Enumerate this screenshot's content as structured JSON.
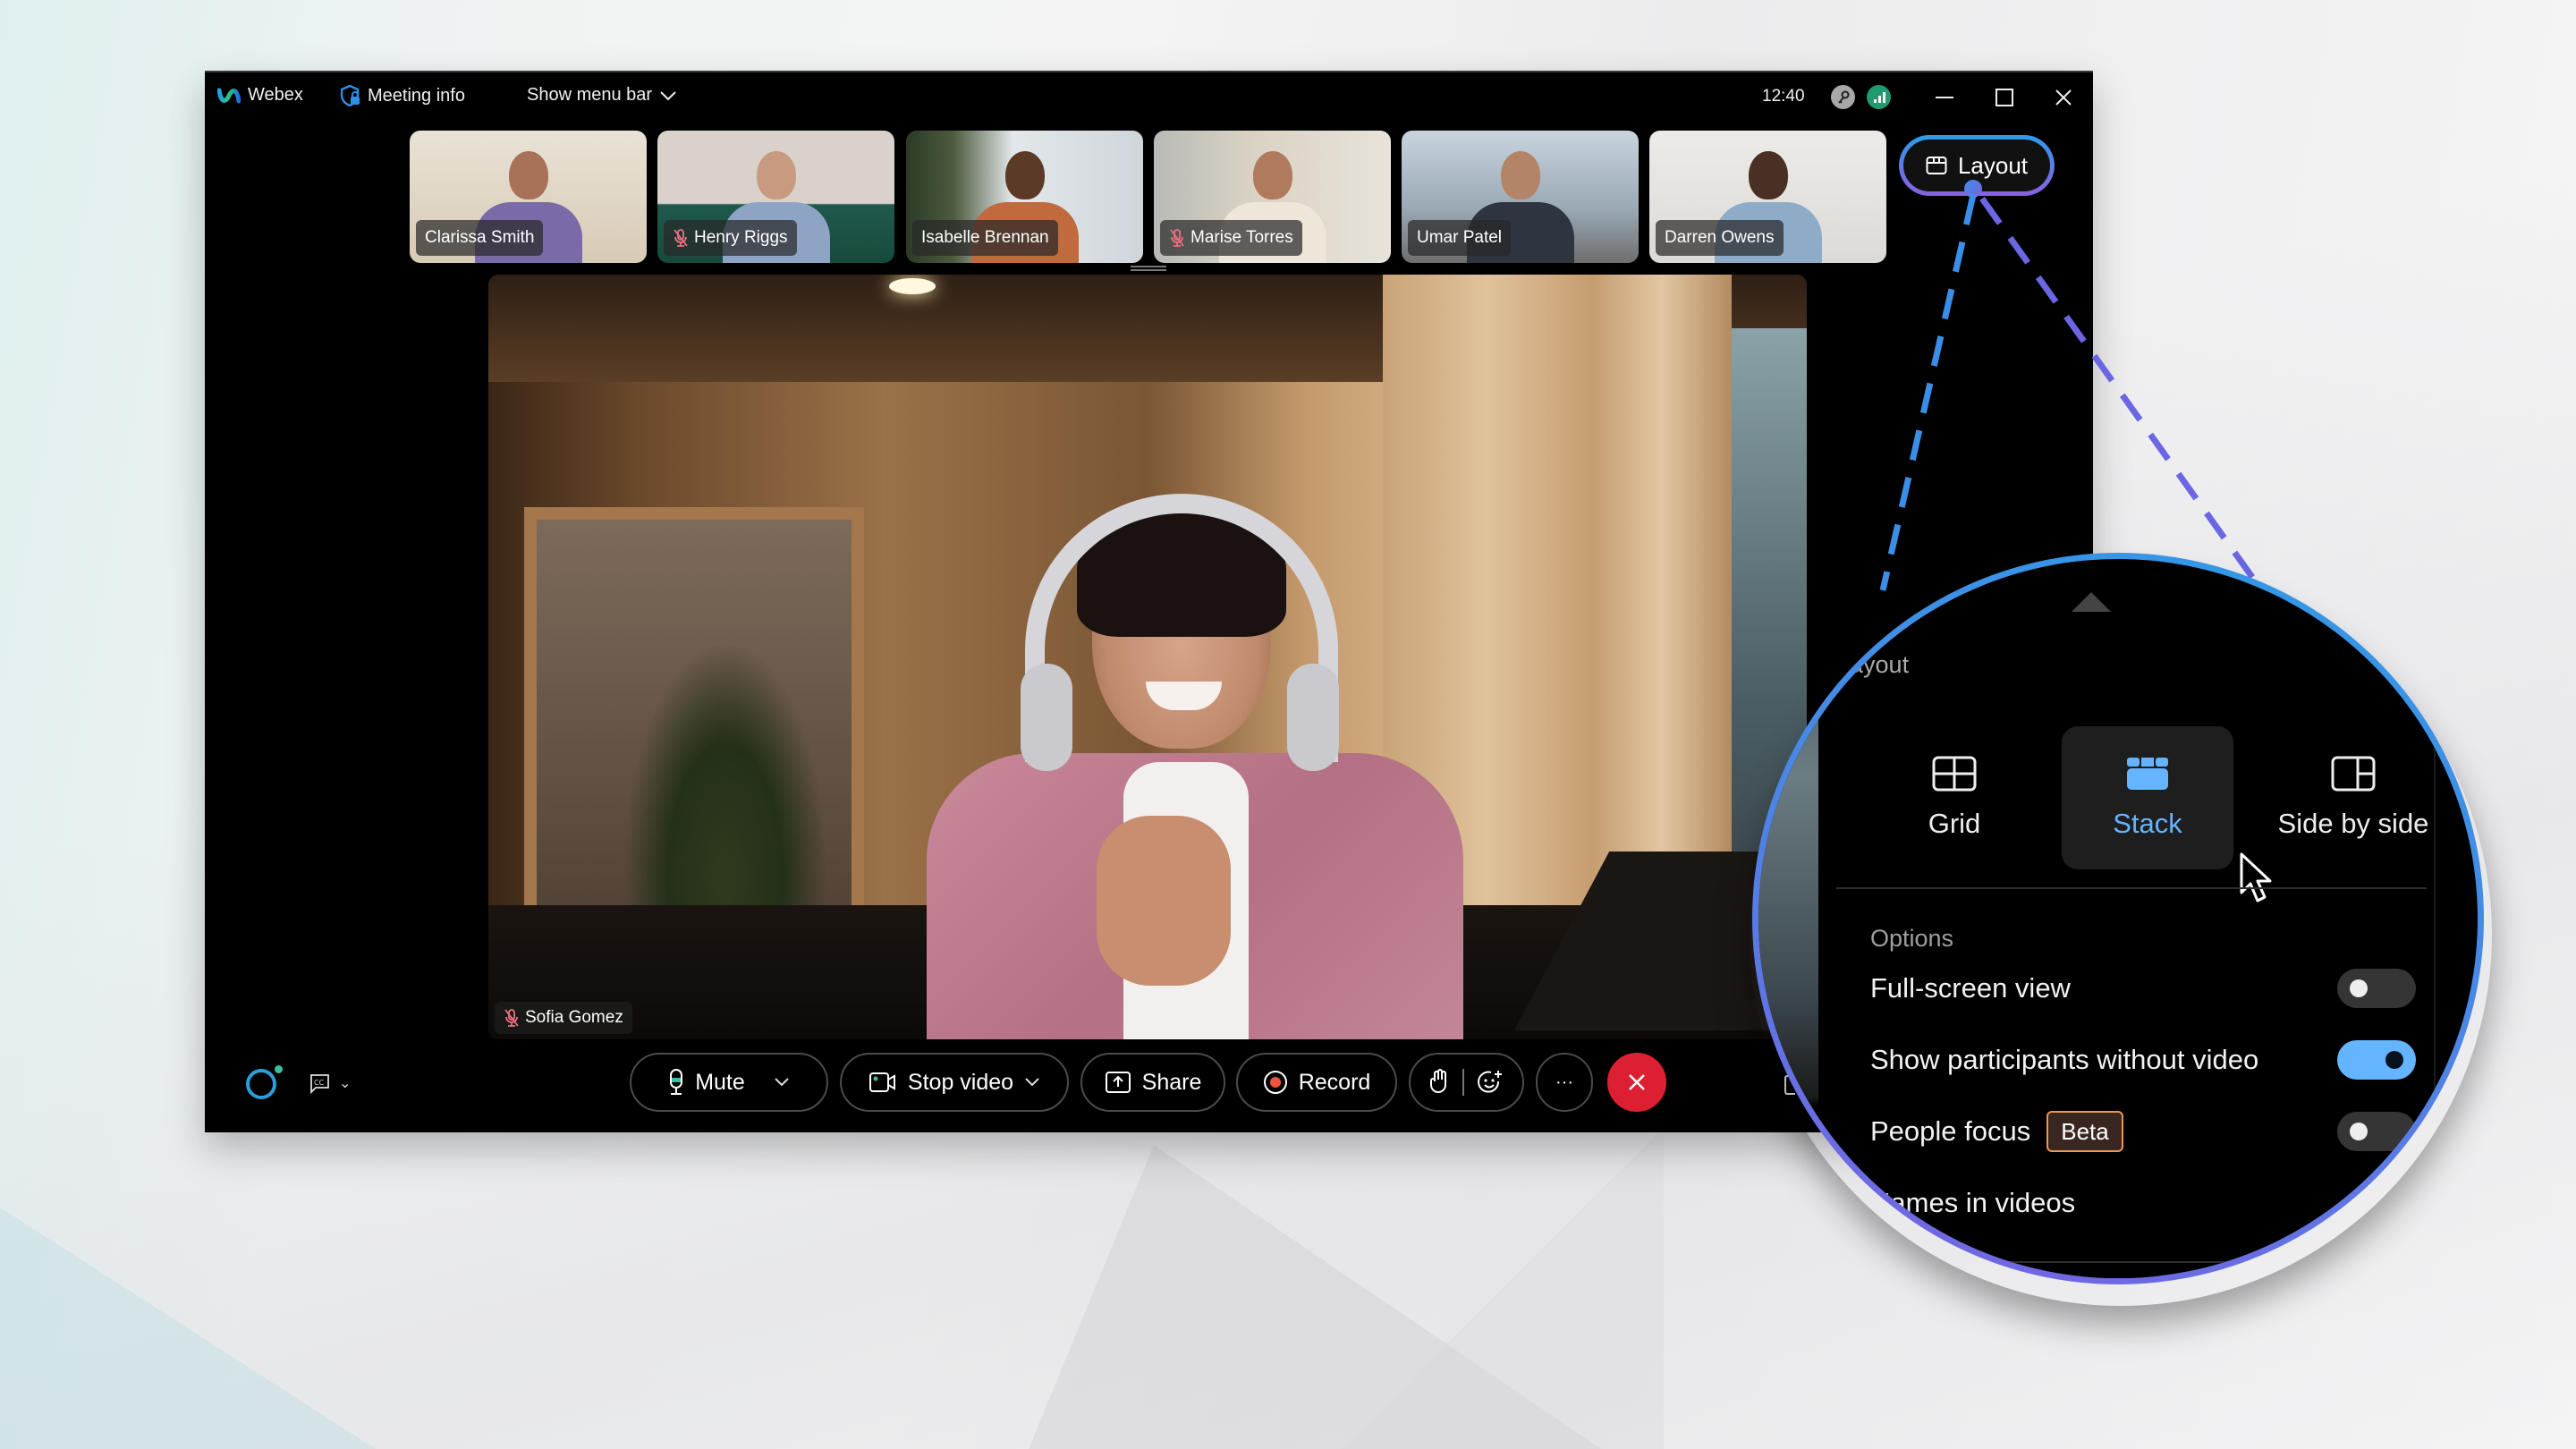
{
  "titlebar": {
    "app_name": "Webex",
    "meeting_info": "Meeting info",
    "show_menu_bar": "Show menu bar",
    "time": "12:40",
    "icons": [
      "webex-logo-icon",
      "shield-lock-icon",
      "chevron-down-icon",
      "key-icon",
      "signal-icon",
      "minimize-icon",
      "maximize-icon",
      "close-icon"
    ]
  },
  "participants": [
    {
      "name": "Clarissa Smith",
      "muted": false
    },
    {
      "name": "Henry Riggs",
      "muted": true
    },
    {
      "name": "Isabelle Brennan",
      "muted": false
    },
    {
      "name": "Marise Torres",
      "muted": true
    },
    {
      "name": "Umar Patel",
      "muted": false
    },
    {
      "name": "Darren Owens",
      "muted": false
    }
  ],
  "active_speaker": {
    "name": "Sofia Gomez",
    "muted": true
  },
  "layout_button": {
    "label": "Layout"
  },
  "controls": {
    "mute": "Mute",
    "stop_video": "Stop video",
    "share": "Share",
    "record": "Record",
    "more": "···",
    "cc": "CC",
    "colors": {
      "leave": "#dc2032",
      "record_dot": "#f0543c",
      "mic_accent": "#3ac0a0"
    }
  },
  "layout_panel": {
    "title": "Layout",
    "options": [
      {
        "label": "Grid",
        "icon": "grid-icon",
        "selected": false
      },
      {
        "label": "Stack",
        "icon": "stack-icon",
        "selected": true
      },
      {
        "label": "Side by side",
        "icon": "side-by-side-icon",
        "selected": false
      }
    ],
    "section_label": "Options",
    "settings": [
      {
        "label": "Full-screen view",
        "on": false
      },
      {
        "label": "Show participants without video",
        "on": true
      },
      {
        "label": "People focus",
        "badge": "Beta",
        "on": false
      },
      {
        "label": "Names in videos",
        "submenu": true
      }
    ],
    "accent": "#64b4ff",
    "badge_color": "#f0954e"
  }
}
